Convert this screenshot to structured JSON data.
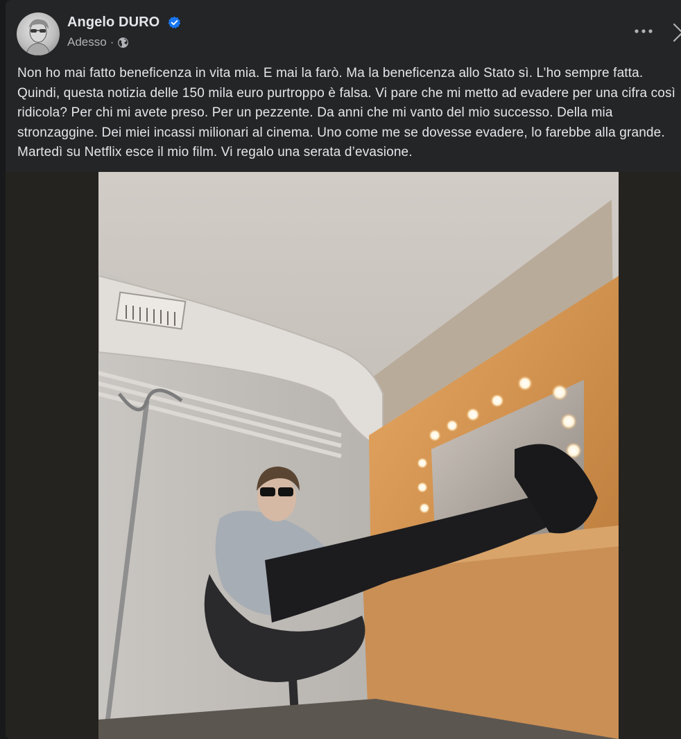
{
  "post": {
    "author": "Angelo DURO",
    "timestamp": "Adesso",
    "audience_icon": "globe-icon",
    "verified_icon": "verified-badge-icon",
    "options_icon": "more-options-icon",
    "close_icon": "close-icon",
    "text": "Non ho mai fatto beneficenza in vita mia. E mai la farò. Ma la beneficenza allo Stato sì. L’ho sempre fatta. Quindi, questa notizia delle 150 mila euro purtroppo è falsa. Vi pare che mi metto ad evadere per una cifra così ridicola? Per chi mi avete preso. Per un pezzente. Da anni che mi vanto del mio successo. Della mia stronzaggine. Dei miei incassi milionari al cinema. Uno come me se dovesse evadere, lo farebbe alla grande. Martedì su Netflix esce il mio film. Vi regalo una serata d’evasione.",
    "separator": "·"
  },
  "colors": {
    "background": "#18191a",
    "card": "#242526",
    "primary_text": "#e4e6eb",
    "secondary_text": "#b0b3b8",
    "verified": "#1877f2"
  }
}
